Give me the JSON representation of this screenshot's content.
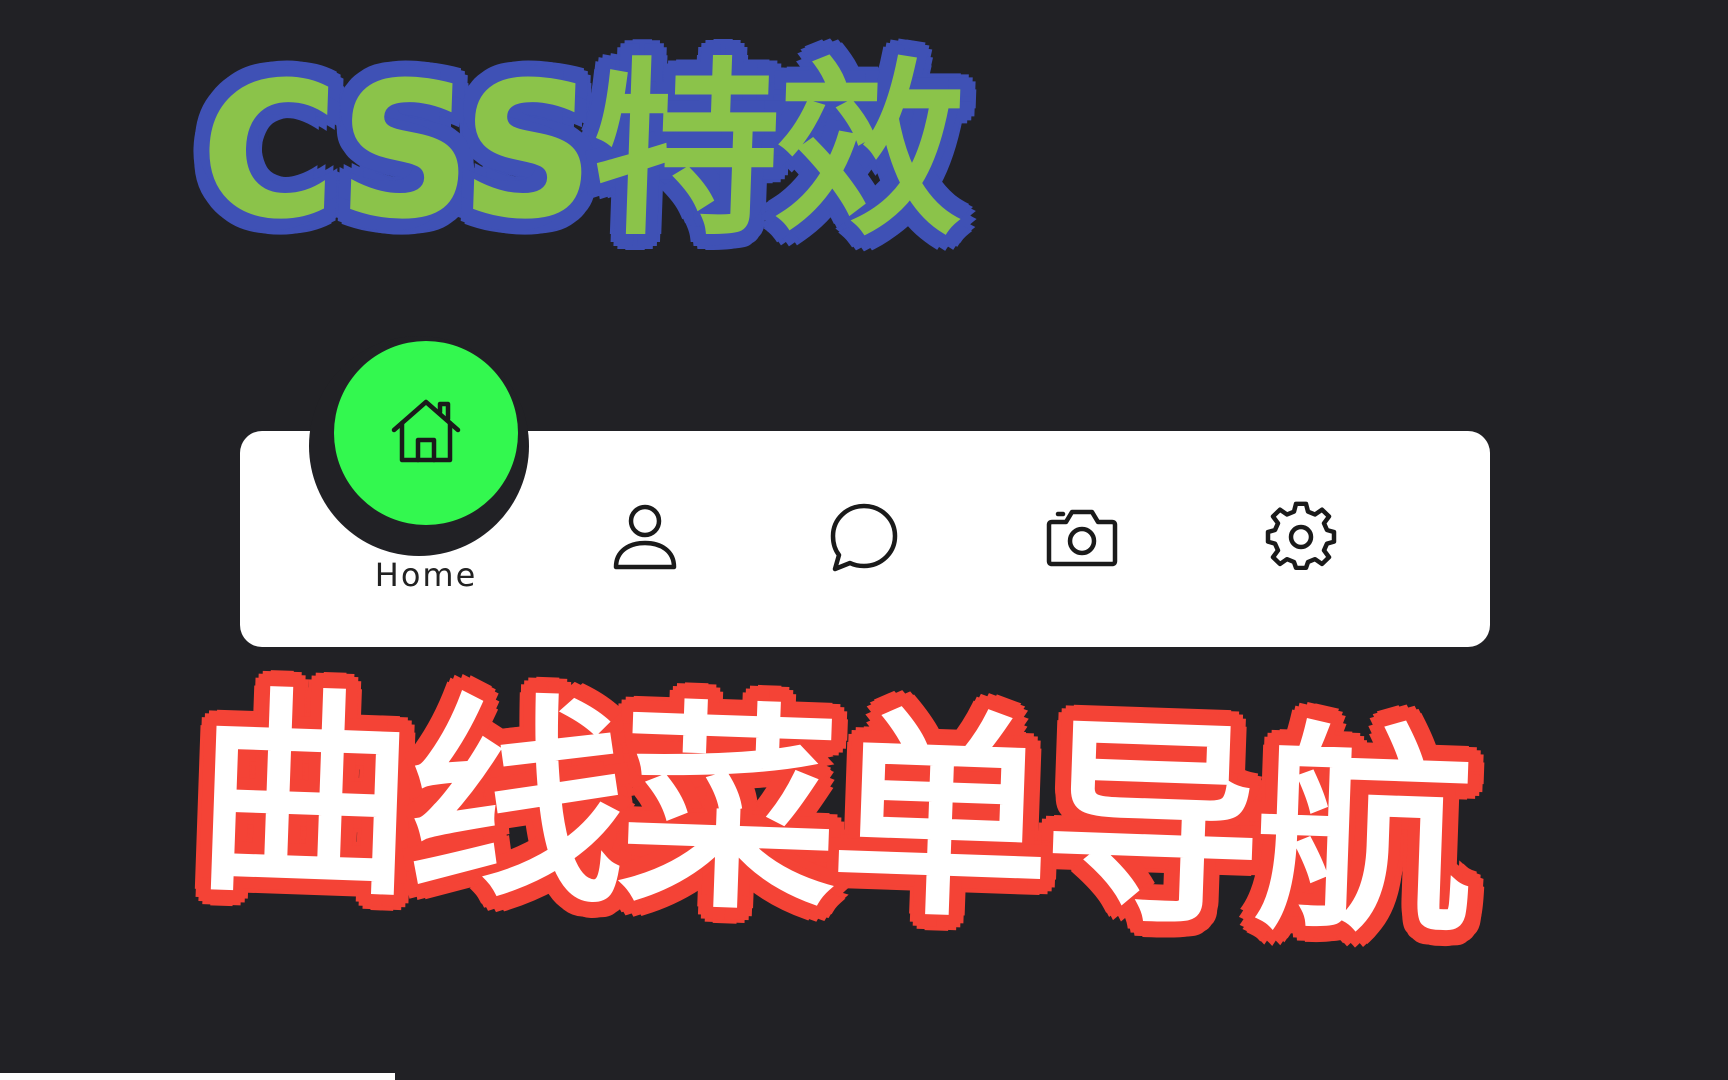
{
  "title_top": "CSS特效",
  "title_bottom": "曲线菜单导航",
  "colors": {
    "background": "#212125",
    "title_top_fill": "#8bc34a",
    "title_top_outline": "#3f51b5",
    "title_bottom_fill": "#ffffff",
    "title_bottom_outline": "#f44336",
    "indicator": "#33f84f",
    "nav_bg": "#ffffff",
    "icon_stroke": "#1a1a1a"
  },
  "nav": {
    "active_index": 0,
    "items": [
      {
        "label": "Home",
        "icon": "home-icon"
      },
      {
        "label": "",
        "icon": "user-icon"
      },
      {
        "label": "",
        "icon": "message-icon"
      },
      {
        "label": "",
        "icon": "camera-icon"
      },
      {
        "label": "",
        "icon": "gear-icon"
      }
    ]
  }
}
